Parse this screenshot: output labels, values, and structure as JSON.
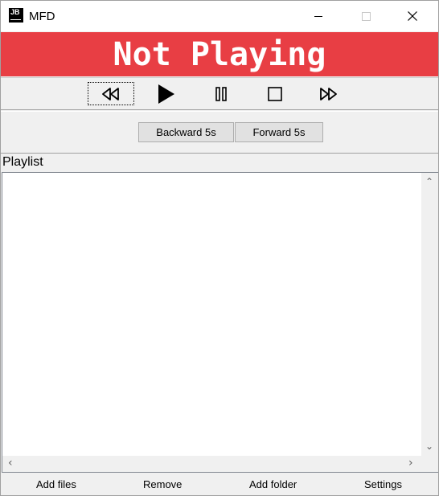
{
  "window": {
    "icon_text": "JB",
    "title": "MFD"
  },
  "status": {
    "text": "Not Playing",
    "color": "#e83e44"
  },
  "transport": {
    "buttons": [
      "rewind-icon",
      "play-icon",
      "pause-icon",
      "stop-icon",
      "fast-forward-icon"
    ]
  },
  "seek": {
    "backward_label": "Backward 5s",
    "forward_label": "Forward 5s"
  },
  "playlist": {
    "label": "Playlist",
    "items": []
  },
  "bottom": {
    "add_files": "Add files",
    "remove": "Remove",
    "add_folder": "Add folder",
    "settings": "Settings"
  }
}
